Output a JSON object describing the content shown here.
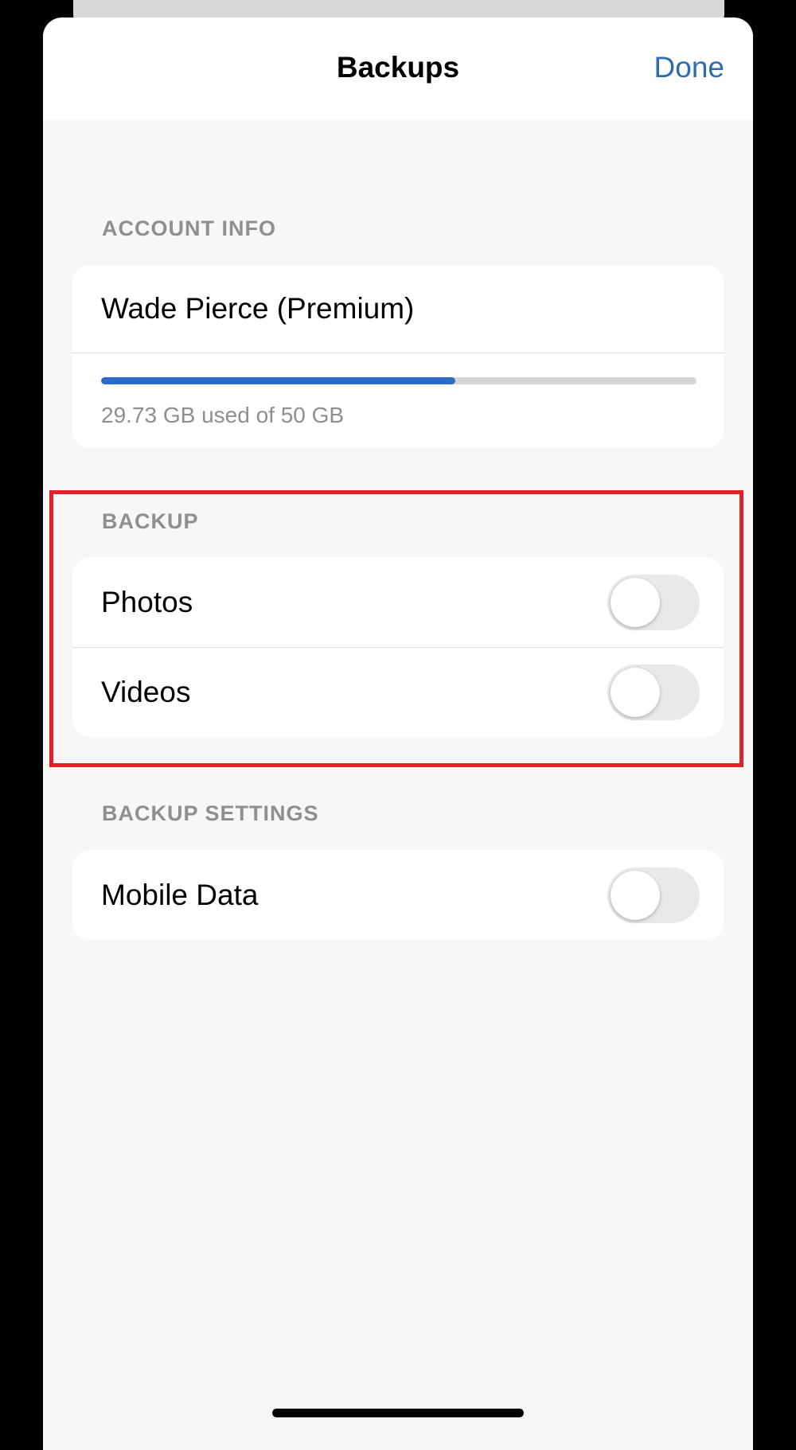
{
  "nav": {
    "title": "Backups",
    "done_label": "Done"
  },
  "account_info": {
    "header": "ACCOUNT INFO",
    "account_name": "Wade Pierce (Premium)",
    "usage_text": "29.73 GB used of 50 GB",
    "used_fraction": 0.5946,
    "progress_color": "#2e6bc6"
  },
  "backup": {
    "header": "BACKUP",
    "items": [
      {
        "label": "Photos",
        "enabled": false
      },
      {
        "label": "Videos",
        "enabled": false
      }
    ]
  },
  "backup_settings": {
    "header": "BACKUP SETTINGS",
    "items": [
      {
        "label": "Mobile Data",
        "enabled": false
      }
    ]
  },
  "colors": {
    "accent": "#2e6bb0",
    "highlight": "#e0202a"
  }
}
